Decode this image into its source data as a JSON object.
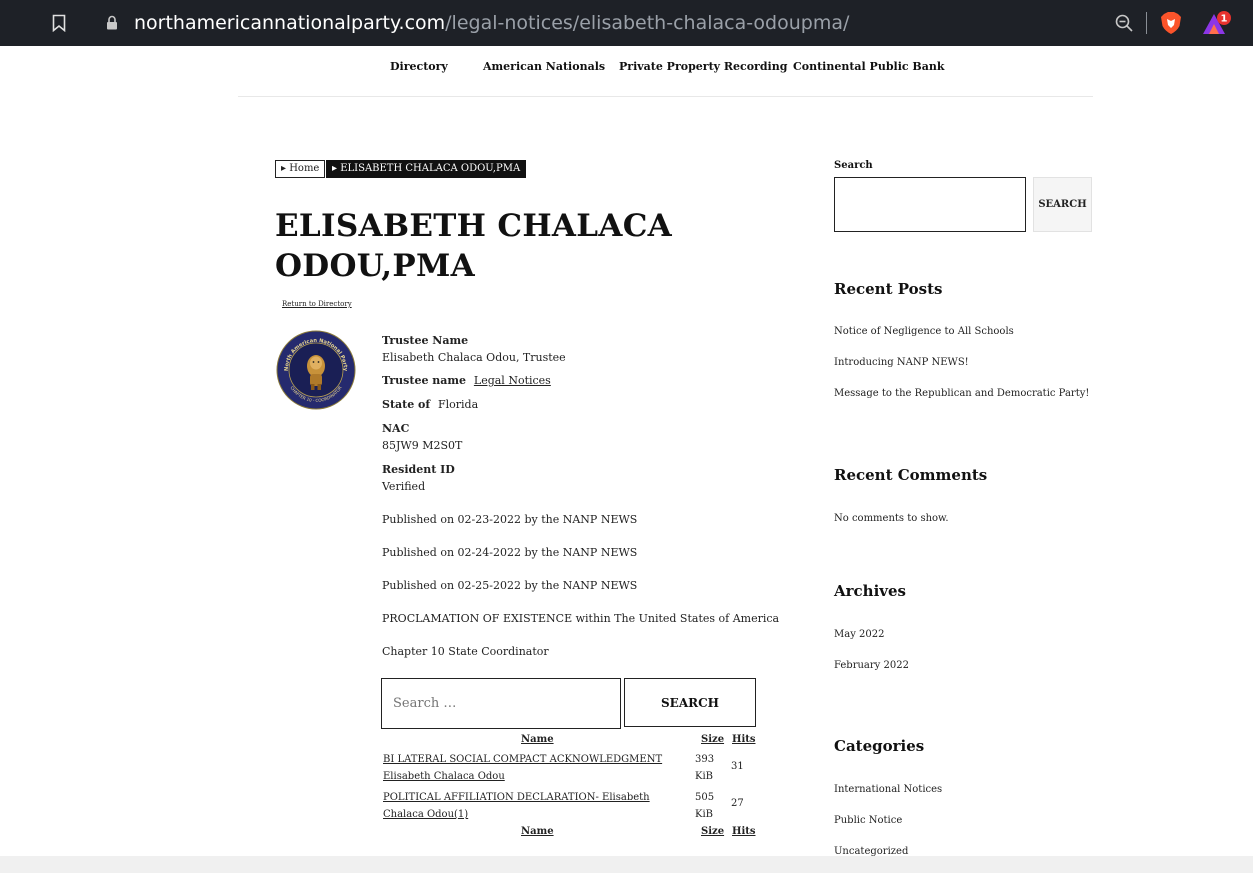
{
  "browser": {
    "url_host": "northamericannationalparty.com",
    "url_path": "/legal-notices/elisabeth-chalaca-odoupma/",
    "rewards_badge": "1",
    "icons": [
      "bookmark-icon",
      "lock-icon",
      "zoom-out-icon",
      "brave-shield-icon",
      "brave-rewards-icon"
    ]
  },
  "nav": {
    "items": [
      "Directory",
      "American Nationals",
      "Private Property Recording",
      "Continental Public Bank"
    ]
  },
  "breadcrumb": {
    "home": "▸ Home",
    "current": "▸ ELISABETH CHALACA ODOU,PMA"
  },
  "page": {
    "title": "ELISABETH CHALACA ODOU,PMA",
    "return_link": "Return to Directory",
    "trustee_name_label": "Trustee Name",
    "trustee_name_value": "Elisabeth Chalaca Odou, Trustee",
    "trustee_name2_label": "Trustee name",
    "trustee_name2_link": "Legal Notices",
    "state_label": "State of",
    "state_value": "Florida",
    "nac_label": "NAC",
    "nac_value": "85JW9 M2S0T",
    "resident_label": "Resident ID",
    "resident_value": "Verified",
    "paragraphs": [
      "Published on 02-23-2022 by the NANP NEWS",
      "Published on 02-24-2022 by the NANP NEWS",
      "Published on 02-25-2022 by the NANP NEWS",
      "PROCLAMATION OF EXISTENCE within The United States of America",
      "Chapter 10 State Coordinator"
    ]
  },
  "seal": {
    "text_top": "North American National Party",
    "text_bottom": "CHAPTER 10 - COORDINATOR"
  },
  "content_search": {
    "placeholder": "Search …",
    "button": "SEARCH"
  },
  "files_table": {
    "headers": {
      "name": "Name",
      "size": "Size",
      "hits": "Hits"
    },
    "rows": [
      {
        "name": "BI LATERAL SOCIAL COMPACT ACKNOWLEDGMENT Elisabeth Chalaca Odou",
        "size": "393 KiB",
        "hits": "31"
      },
      {
        "name": "POLITICAL AFFILIATION DECLARATION- Elisabeth Chalaca Odou(1)",
        "size": "505 KiB",
        "hits": "27"
      }
    ]
  },
  "sidebar": {
    "search_label": "Search",
    "search_button": "SEARCH",
    "recent_posts_heading": "Recent Posts",
    "recent_posts": [
      "Notice of Negligence to All Schools",
      "Introducing NANP NEWS!",
      "Message to the Republican and Democratic Party!"
    ],
    "recent_comments_heading": "Recent Comments",
    "recent_comments_empty": "No comments to show.",
    "archives_heading": "Archives",
    "archives": [
      "May 2022",
      "February 2022"
    ],
    "categories_heading": "Categories",
    "categories": [
      "International Notices",
      "Public Notice",
      "Uncategorized"
    ]
  }
}
